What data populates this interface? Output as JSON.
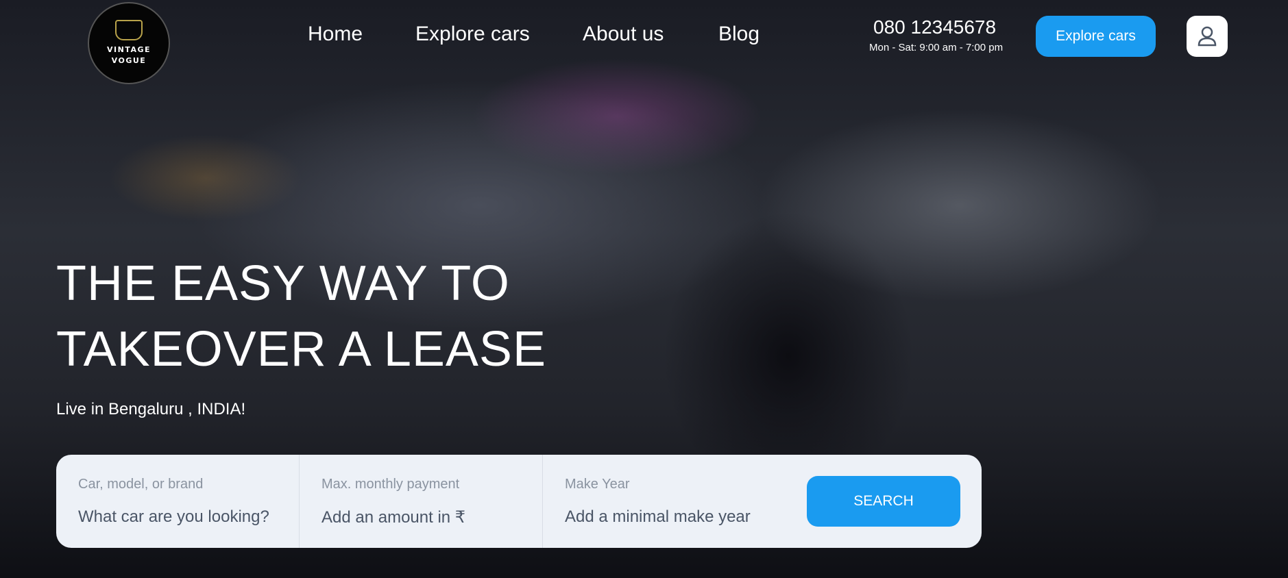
{
  "logo": {
    "line1": "VINTAGE",
    "line2": "VOGUE"
  },
  "nav": [
    "Home",
    "Explore cars",
    "About us",
    "Blog"
  ],
  "contact": {
    "phone": "080 12345678",
    "hours": "Mon - Sat: 9:00 am - 7:00 pm"
  },
  "header": {
    "cta": "Explore cars"
  },
  "hero": {
    "title_line1": "THE EASY WAY TO",
    "title_line2": "TAKEOVER A LEASE",
    "subtitle": "Live in Bengaluru , INDIA!"
  },
  "search": {
    "fields": [
      {
        "label": "Car, model, or brand",
        "placeholder": "What car are you looking?"
      },
      {
        "label": "Max. monthly payment",
        "placeholder": "Add an amount in ₹"
      },
      {
        "label": "Make Year",
        "placeholder": "Add a minimal make year"
      }
    ],
    "button": "SEARCH"
  }
}
